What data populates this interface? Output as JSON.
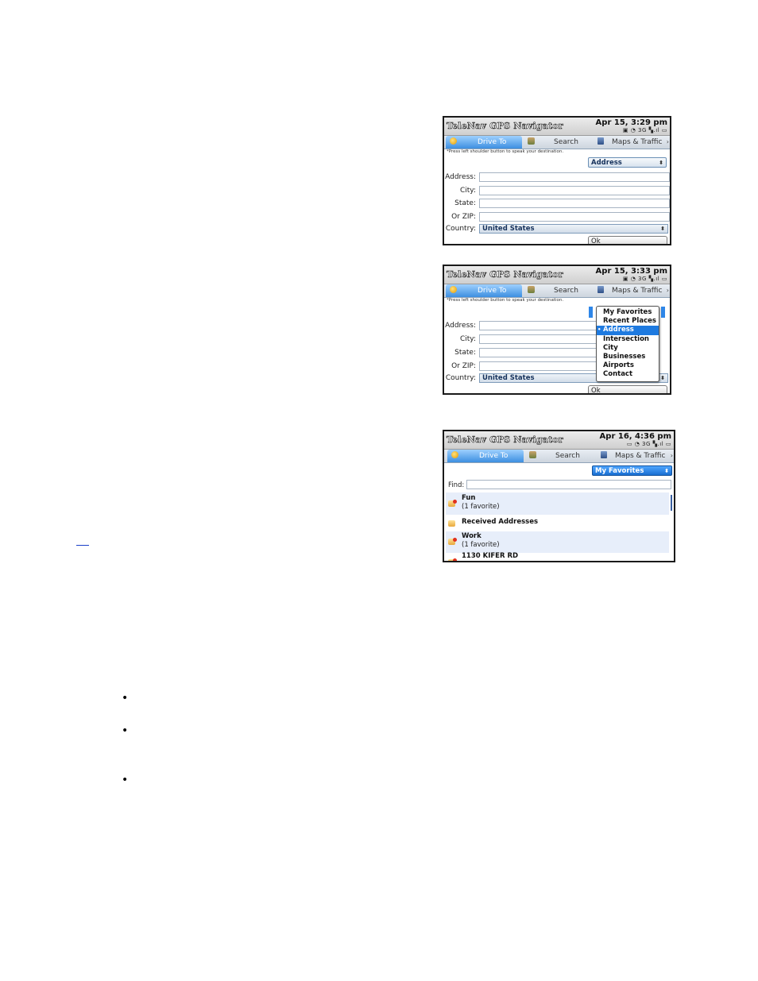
{
  "shots": [
    {
      "app_title": "TeleNav GPS Navigator",
      "clock": "Apr 15, 3:29 pm",
      "status_icons": "▣ ◔ 3G ▚.ıl ▭",
      "tabs": [
        "Drive To",
        "Search",
        "Maps & Traffic"
      ],
      "hint": "*Press left shoulder button to speak your destination.",
      "type_select": "Address",
      "fields": [
        "Address:",
        "City:",
        "State:",
        "Or ZIP:"
      ],
      "country_label": "Country:",
      "country_value": "United States",
      "ok_label": "Ok"
    },
    {
      "app_title": "TeleNav GPS Navigator",
      "clock": "Apr 15, 3:33 pm",
      "status_icons": "▣ ◔ 3G ▚.ıl ▭",
      "tabs": [
        "Drive To",
        "Search",
        "Maps & Traffic"
      ],
      "hint": "*Press left shoulder button to speak your destination.",
      "menu_items": [
        "My Favorites",
        "Recent Places",
        "Address",
        "Intersection",
        "City",
        "Businesses",
        "Airports",
        "Contact"
      ],
      "menu_selected": "Address",
      "fields": [
        "Address:",
        "City:",
        "State:",
        "Or ZIP:"
      ],
      "country_label": "Country:",
      "country_value": "United States",
      "ok_label": "Ok"
    },
    {
      "app_title": "TeleNav GPS Navigator",
      "clock": "Apr 16, 4:36 pm",
      "status_icons": "▭ ◔ 3G ▚.ıl ▭",
      "tabs": [
        "Drive To",
        "Search",
        "Maps & Traffic"
      ],
      "type_select": "My Favorites",
      "find_label": "Find:",
      "list": [
        {
          "title": "Fun",
          "sub": "(1 favorite)"
        },
        {
          "title": "Received Addresses",
          "sub": ""
        },
        {
          "title": "Work",
          "sub": "(1 favorite)"
        },
        {
          "title": "1130 KIFER RD",
          "sub": ""
        }
      ]
    }
  ],
  "page": {
    "bullets": [
      "•",
      "•",
      "•"
    ]
  },
  "colors": {
    "accent": "#1e7ae0",
    "tab_active": "#3d8fe0",
    "select_text": "#16325c"
  }
}
